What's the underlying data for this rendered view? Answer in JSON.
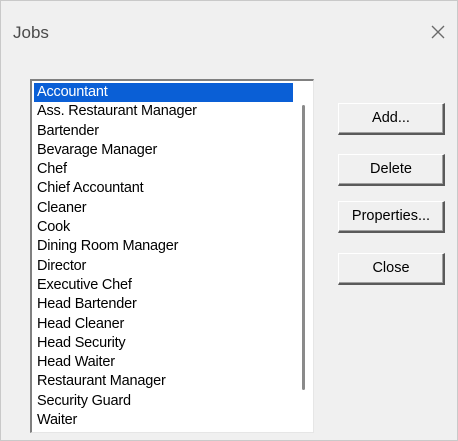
{
  "window": {
    "title": "Jobs"
  },
  "icons": {
    "close": "close-icon",
    "scroll_thumb": "scrollbar-thumb"
  },
  "jobs_list": {
    "selected_index": 0,
    "items": [
      "Accountant",
      "Ass. Restaurant Manager",
      "Bartender",
      "Bevarage Manager",
      "Chef",
      "Chief Accountant",
      "Cleaner",
      "Cook",
      "Dining Room Manager",
      "Director",
      "Executive Chef",
      "Head Bartender",
      "Head Cleaner",
      "Head Security",
      "Head Waiter",
      "Restaurant Manager",
      "Security Guard",
      "Waiter"
    ]
  },
  "buttons": {
    "add": "Add...",
    "delete": "Delete",
    "properties": "Properties...",
    "close": "Close"
  },
  "colors": {
    "selection": "#0a5fd6",
    "dialog_bg": "#f0f0f0"
  }
}
